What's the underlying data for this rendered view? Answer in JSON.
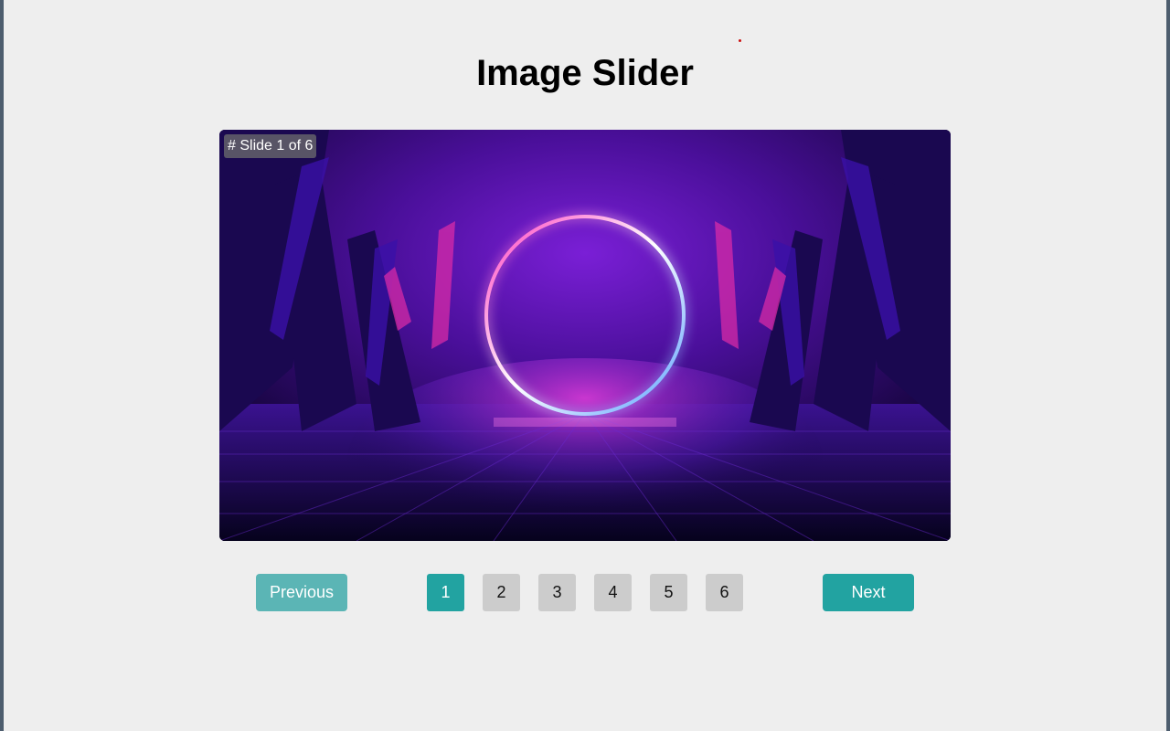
{
  "page": {
    "title": "Image Slider"
  },
  "slider": {
    "label": "# Slide 1 of 6",
    "current": 1,
    "total": 6,
    "image_icon": "neon-ring-image"
  },
  "controls": {
    "previous_label": "Previous",
    "next_label": "Next",
    "pages": [
      "1",
      "2",
      "3",
      "4",
      "5",
      "6"
    ]
  },
  "colors": {
    "accent": "#22a3a1",
    "accent_disabled": "#5bb5b5",
    "page_button": "#cccccc",
    "background": "#eeeeee"
  }
}
